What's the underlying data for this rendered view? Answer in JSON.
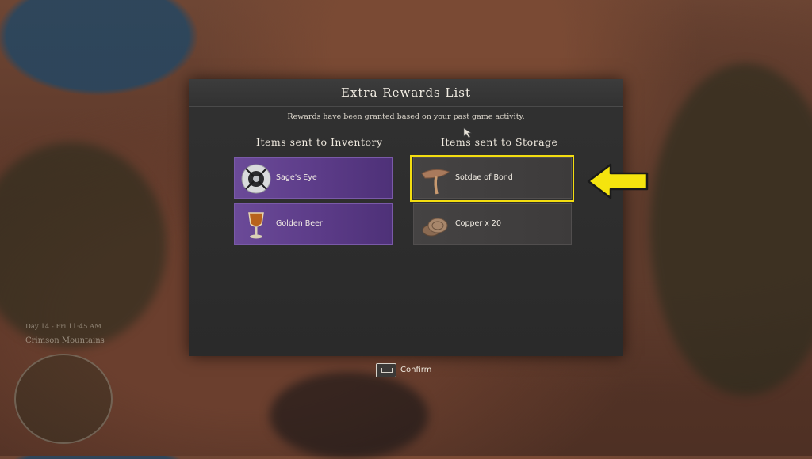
{
  "dialog": {
    "title": "Extra Rewards List",
    "subtitle": "Rewards have been granted based on your past game activity.",
    "inventory_title": "Items sent to Inventory",
    "storage_title": "Items sent to Storage",
    "inventory_items": [
      {
        "label": "Sage's Eye",
        "rarity": "purple",
        "icon": "sages-eye-icon"
      },
      {
        "label": "Golden Beer",
        "rarity": "purple",
        "icon": "golden-beer-icon"
      }
    ],
    "storage_items": [
      {
        "label": "Sotdae of Bond",
        "rarity": "grey",
        "icon": "sotdae-icon",
        "highlighted": true
      },
      {
        "label": "Copper x 20",
        "rarity": "grey",
        "icon": "copper-coins-icon"
      }
    ],
    "confirm_label": "Confirm"
  },
  "hud": {
    "day_time": "Day 14 - Fri 11:45 AM",
    "location": "Crimson Mountains"
  },
  "colors": {
    "highlight": "#f3dd10",
    "purple_slot": "#5a3a86",
    "grey_slot": "#403e3e",
    "panel": "#2d2d2d"
  }
}
